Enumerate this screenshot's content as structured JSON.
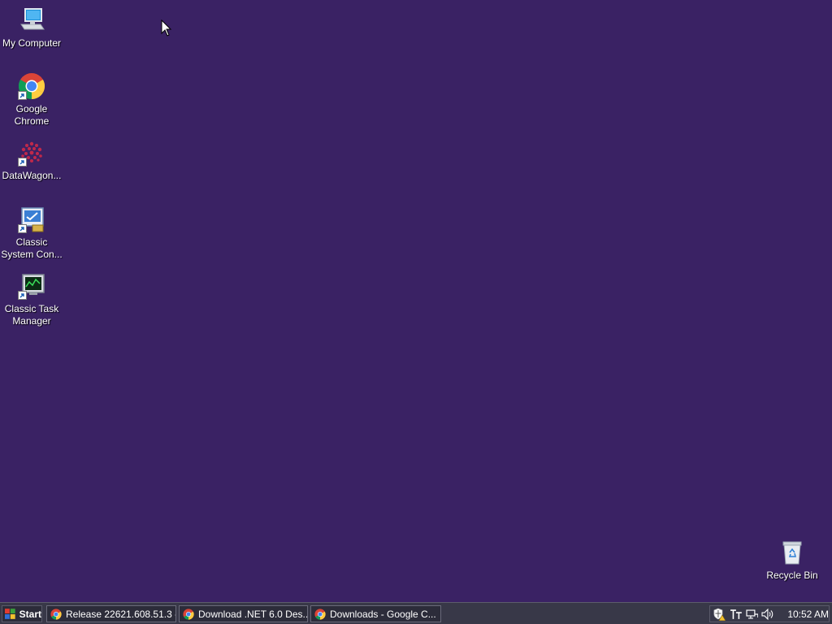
{
  "desktop": {
    "background": "#3a2264",
    "icons": [
      {
        "label": "My Computer",
        "icon": "computer-icon"
      },
      {
        "label": "Google Chrome",
        "icon": "chrome-icon"
      },
      {
        "label": "DataWagon...",
        "icon": "datawagon-icon"
      },
      {
        "label": "Classic System Con...",
        "icon": "control-panel-icon"
      },
      {
        "label": "Classic Task Manager",
        "icon": "task-manager-icon"
      }
    ],
    "recycle_bin": {
      "label": "Recycle Bin",
      "icon": "recycle-bin-icon"
    }
  },
  "taskbar": {
    "start_label": "Start",
    "tasks": [
      {
        "label": "Release 22621.608.51.3 -...",
        "icon": "chrome-icon"
      },
      {
        "label": "Download .NET 6.0 Des...",
        "icon": "chrome-icon"
      },
      {
        "label": "Downloads - Google C...",
        "icon": "chrome-icon"
      }
    ],
    "tray": {
      "icons": [
        "security-shield-icon",
        "language-icon",
        "network-icon",
        "volume-icon"
      ],
      "clock": "10:52 AM"
    }
  }
}
